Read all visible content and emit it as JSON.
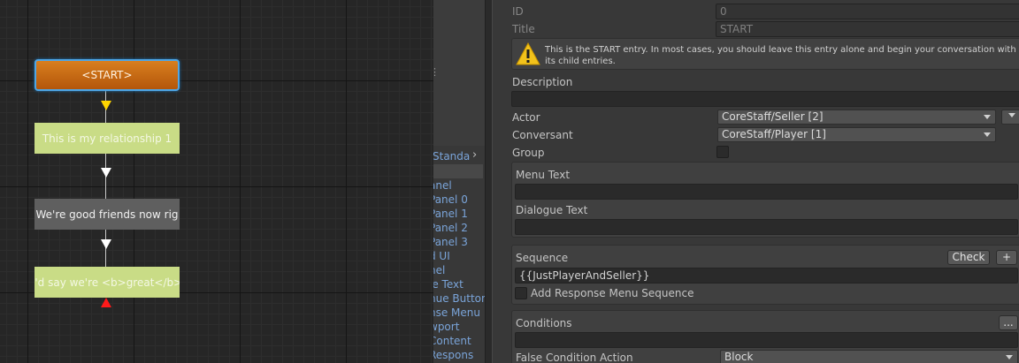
{
  "graph": {
    "nodes": [
      {
        "text": "<START>"
      },
      {
        "text": "This is my relationship 1"
      },
      {
        "text": "We're good friends now rig"
      },
      {
        "text": "I'd say we're <b>great</b>"
      }
    ],
    "colors": {
      "start_node": "#c66a14",
      "selected_outline": "#4ea6e6",
      "green_node": "#c9dc86",
      "gray_node": "#5f5f5f",
      "start_arrow": "#ffd600",
      "end_arrow": "#ff1a1a"
    }
  },
  "hierarchy": {
    "breadcrumb": "Standa",
    "items": [
      "anel",
      "Panel 0",
      "Panel 1",
      "Panel 2",
      "Panel 3",
      "d UI",
      "nel",
      "le Text",
      "nue Button",
      "nse Menu",
      "wport",
      "Content",
      "Respons"
    ]
  },
  "inspector": {
    "id_label": "ID",
    "id_value": "0",
    "title_label": "Title",
    "title_value": "START",
    "warning_icon": "warning-triangle-icon",
    "warning_text": "This is the START entry. In most cases, you should leave this entry alone and begin your conversation with its child entries.",
    "description_label": "Description",
    "description_value": "",
    "actor_label": "Actor",
    "actor_value": "CoreStaff/Seller [2]",
    "conversant_label": "Conversant",
    "conversant_value": "CoreStaff/Player [1]",
    "group_label": "Group",
    "menu_text_label": "Menu Text",
    "menu_text_value": "",
    "dialogue_text_label": "Dialogue Text",
    "dialogue_text_value": "",
    "sequence_label": "Sequence",
    "check_button": "Check",
    "plus_button": "+",
    "sequence_value": "{{JustPlayerAndSeller}}",
    "add_response_label": "Add Response Menu Sequence",
    "conditions_label": "Conditions",
    "conditions_button": "...",
    "conditions_value": "",
    "false_condition_label": "False Condition Action",
    "false_condition_value": "Block"
  }
}
